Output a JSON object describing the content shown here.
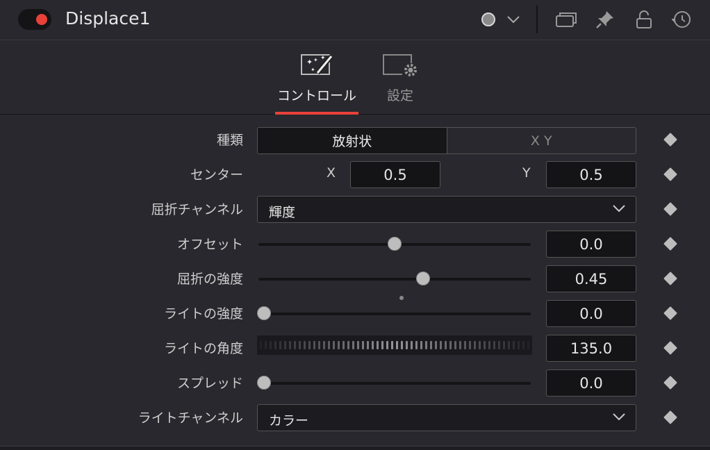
{
  "header": {
    "title": "Displace1",
    "icons": [
      "toggle-switch",
      "color-dot-icon",
      "chevron-down-icon",
      "windows-icon",
      "pin-icon",
      "lock-icon",
      "reset-icon"
    ]
  },
  "tabs": [
    {
      "label": "コントロール",
      "icon": "magic-wand-icon",
      "active": true
    },
    {
      "label": "設定",
      "icon": "settings-icon",
      "active": false
    }
  ],
  "controls": {
    "type": {
      "label": "種類",
      "options": [
        "放射状",
        "X Y"
      ],
      "selected": "放射状"
    },
    "center": {
      "label": "センター",
      "x_label": "X",
      "x_value": "0.5",
      "y_label": "Y",
      "y_value": "0.5"
    },
    "refraction_channel": {
      "label": "屈折チャンネル",
      "value": "輝度"
    },
    "offset": {
      "label": "オフセット",
      "value": "0.0",
      "slider": 0.5
    },
    "refraction_strength": {
      "label": "屈折の強度",
      "value": "0.45",
      "slider": 0.61,
      "default_marker": 0.525
    },
    "light_strength": {
      "label": "ライトの強度",
      "value": "0.0",
      "slider": 0.0
    },
    "light_angle": {
      "label": "ライトの角度",
      "value": "135.0"
    },
    "spread": {
      "label": "スプレッド",
      "value": "0.0",
      "slider": 0.0
    },
    "light_channel": {
      "label": "ライトチャンネル",
      "value": "カラー"
    }
  },
  "colors": {
    "accent": "#e8413a",
    "background": "#28282e",
    "field": "#141416"
  }
}
